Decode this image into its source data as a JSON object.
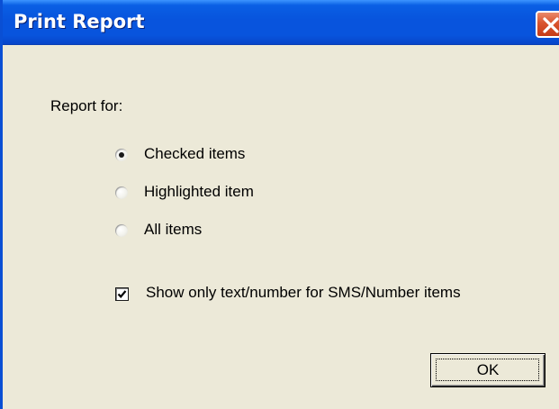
{
  "window": {
    "title": "Print Report",
    "close_icon": "close-icon"
  },
  "report_for": {
    "label": "Report for:",
    "options": [
      {
        "label": "Checked items",
        "selected": true
      },
      {
        "label": "Highlighted item",
        "selected": false
      },
      {
        "label": "All items",
        "selected": false
      }
    ]
  },
  "sms_option": {
    "label": "Show only text/number for SMS/Number items",
    "checked": true
  },
  "ok_button": {
    "label": "OK"
  },
  "colors": {
    "titlebar": "#0854dd",
    "dialog_background": "#ece9d8",
    "close_button": "#d9532d"
  }
}
